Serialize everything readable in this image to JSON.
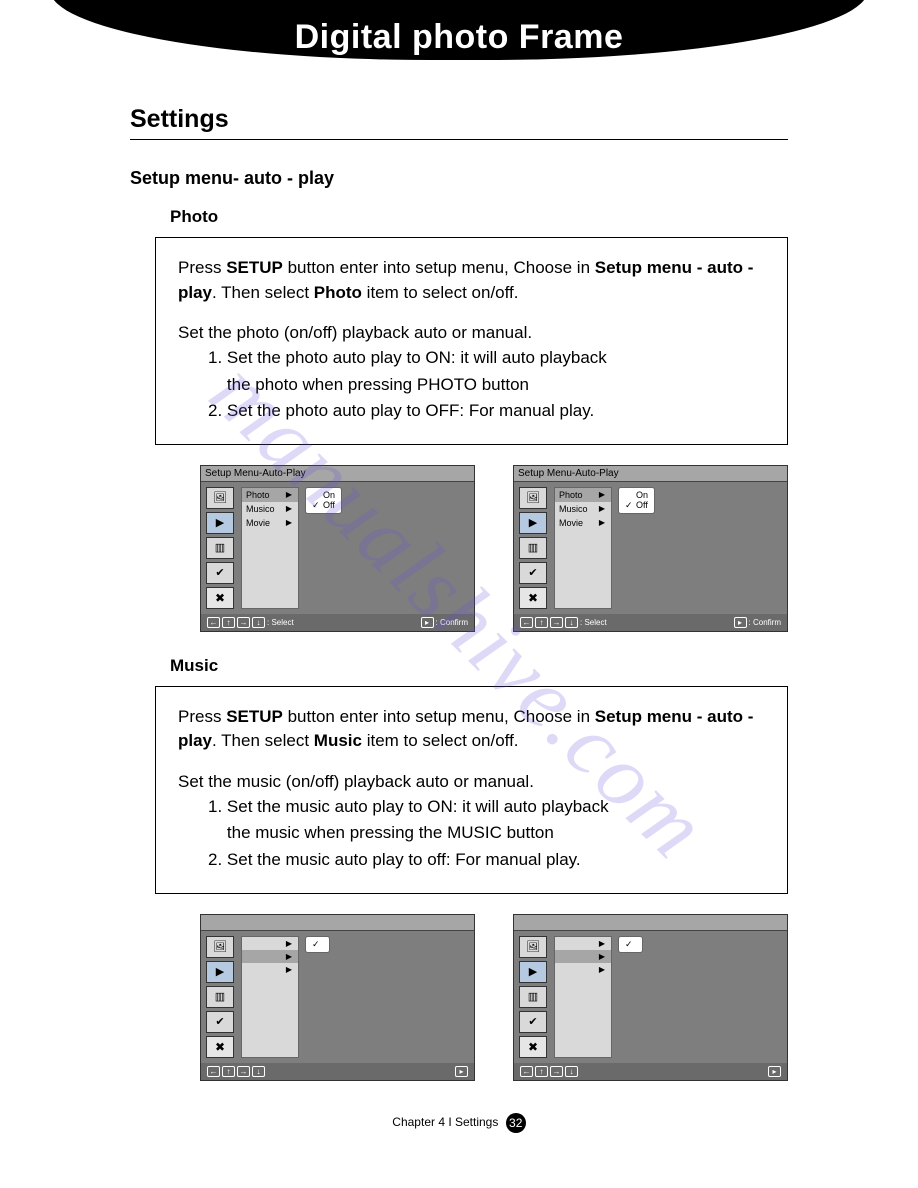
{
  "banner": {
    "title": "Digital photo Frame"
  },
  "section": {
    "title": "Settings"
  },
  "subheading": "Setup menu- auto - play",
  "watermark": "manualshive.com",
  "photo": {
    "label": "Photo",
    "p1_pre": "Press ",
    "p1_b1": "SETUP",
    "p1_mid": " button enter into setup menu,  Choose in ",
    "p1_b2": "Setup menu - auto - play",
    "p1_mid2": ". Then select ",
    "p1_b3": "Photo",
    "p1_post": " item to select on/off.",
    "p2": "Set the photo (on/off) playback auto or manual.",
    "li1a": "1. Set the photo auto play to ON: it will auto playback",
    "li1b": "    the photo when pressing PHOTO button",
    "li2": "2. Set the photo auto play to OFF: For manual play."
  },
  "music": {
    "label": "Music",
    "p1_pre": "Press ",
    "p1_b1": "SETUP",
    "p1_mid": " button enter into setup menu,  Choose in ",
    "p1_b2": "Setup menu - auto - play",
    "p1_mid2": ". Then select ",
    "p1_b3": "Music",
    "p1_post": " item to select on/off.",
    "p2": "Set the music (on/off) playback auto or manual.",
    "li1a": "1. Set the music auto play to ON: it will auto playback",
    "li1b": "    the music when pressing the MUSIC button",
    "li2": "2. Set the music auto play to off:  For manual play."
  },
  "panel": {
    "title": "Setup Menu-Auto-Play",
    "menu": {
      "photo": "Photo",
      "music": "Musico",
      "movie": "Movie"
    },
    "options": {
      "on": "On",
      "off": "Off"
    },
    "footer": {
      "select": ": Select",
      "confirm": ": Confirm"
    }
  },
  "footer": {
    "chapter": "Chapter 4 I Settings",
    "page": "32"
  }
}
